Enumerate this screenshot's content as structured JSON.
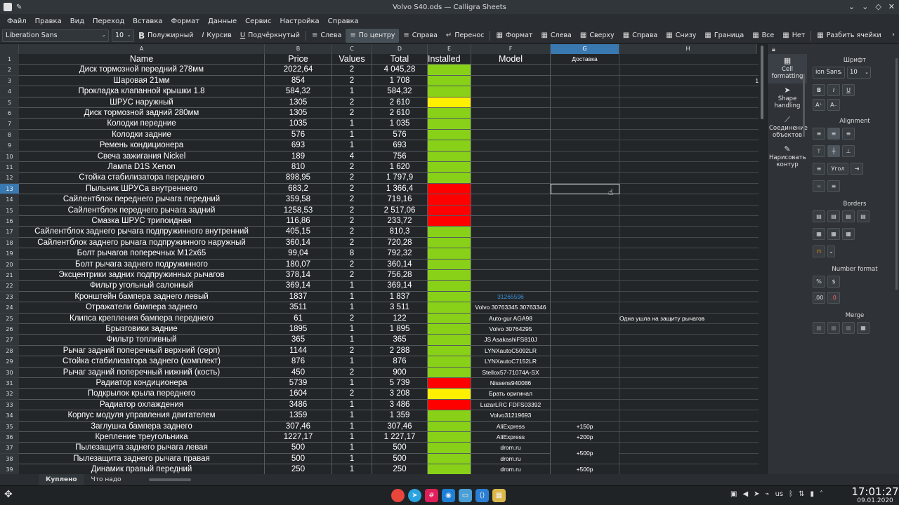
{
  "window": {
    "title": "Volvo S40.ods — Calligra Sheets"
  },
  "menu": [
    "Файл",
    "Правка",
    "Вид",
    "Переход",
    "Вставка",
    "Формат",
    "Данные",
    "Сервис",
    "Настройка",
    "Справка"
  ],
  "toolbar": {
    "font": "Liberation Sans",
    "size": "10",
    "bold": "Полужирный",
    "italic": "Курсив",
    "underline": "Подчёркнутый",
    "left": "Слева",
    "center": "По центру",
    "right": "Справа",
    "wrap": "Перенос",
    "format": "Формат",
    "b_left": "Слева",
    "b_top": "Сверху",
    "b_right": "Справа",
    "b_bottom": "Снизу",
    "b_border": "Граница",
    "b_all": "Все",
    "b_none": "Нет",
    "split": "Разбить ячейки"
  },
  "columns": [
    "A",
    "B",
    "C",
    "D",
    "E",
    "F",
    "G",
    "H"
  ],
  "header": {
    "name": "Name",
    "price": "Price",
    "values": "Values",
    "total": "Total",
    "installed": "Installed",
    "model": "Model",
    "g": "Доставка"
  },
  "rows": [
    {
      "n": "2",
      "a": "Диск тормозной передний 278мм",
      "b": "2022,64",
      "c": "2",
      "d": "4 045,28",
      "e": "green",
      "f": "",
      "g": "",
      "h": "",
      "i": ""
    },
    {
      "n": "3",
      "a": "Шаровая 21мм",
      "b": "854",
      "c": "2",
      "d": "1 708",
      "e": "green",
      "f": "",
      "g": "",
      "h": "",
      "i": "1"
    },
    {
      "n": "4",
      "a": "Прокладка клапанной крышки 1.8",
      "b": "584,32",
      "c": "1",
      "d": "584,32",
      "e": "green",
      "f": "",
      "g": "",
      "h": "",
      "i": ""
    },
    {
      "n": "5",
      "a": "ШРУС наружный",
      "b": "1305",
      "c": "2",
      "d": "2 610",
      "e": "yellow",
      "f": "",
      "g": "",
      "h": "",
      "i": ""
    },
    {
      "n": "6",
      "a": "Диск тормозной задний 280мм",
      "b": "1305",
      "c": "2",
      "d": "2 610",
      "e": "green",
      "f": "",
      "g": "",
      "h": "",
      "i": ""
    },
    {
      "n": "7",
      "a": "Колодки передние",
      "b": "1035",
      "c": "1",
      "d": "1 035",
      "e": "green",
      "f": "",
      "g": "",
      "h": "",
      "i": ""
    },
    {
      "n": "8",
      "a": "Колодки задние",
      "b": "576",
      "c": "1",
      "d": "576",
      "e": "green",
      "f": "",
      "g": "",
      "h": "",
      "i": ""
    },
    {
      "n": "9",
      "a": "Ремень кондиционера",
      "b": "693",
      "c": "1",
      "d": "693",
      "e": "green",
      "f": "",
      "g": "",
      "h": "",
      "i": ""
    },
    {
      "n": "10",
      "a": "Свеча зажигания Nickel",
      "b": "189",
      "c": "4",
      "d": "756",
      "e": "green",
      "f": "",
      "g": "",
      "h": "",
      "i": ""
    },
    {
      "n": "11",
      "a": "Лампа D1S Xenon",
      "b": "810",
      "c": "2",
      "d": "1 620",
      "e": "green",
      "f": "",
      "g": "",
      "h": "",
      "i": ""
    },
    {
      "n": "12",
      "a": "Стойка стабилизатора переднего",
      "b": "898,95",
      "c": "2",
      "d": "1 797,9",
      "e": "green",
      "f": "",
      "g": "",
      "h": "",
      "i": ""
    },
    {
      "n": "13",
      "a": "Пыльник ШРУСа внутреннего",
      "b": "683,2",
      "c": "2",
      "d": "1 366,4",
      "e": "red",
      "f": "",
      "g": "",
      "h": "",
      "i": ""
    },
    {
      "n": "14",
      "a": "Сайлентблок переднего рычага передний",
      "b": "359,58",
      "c": "2",
      "d": "719,16",
      "e": "red",
      "f": "",
      "g": "",
      "h": "",
      "i": ""
    },
    {
      "n": "15",
      "a": "Сайлентблок переднего рычага задний",
      "b": "1258,53",
      "c": "2",
      "d": "2 517,06",
      "e": "red",
      "f": "",
      "g": "",
      "h": "",
      "i": ""
    },
    {
      "n": "16",
      "a": "Смазка ШРУС трипоидная",
      "b": "116,86",
      "c": "2",
      "d": "233,72",
      "e": "red",
      "f": "",
      "g": "",
      "h": "",
      "i": ""
    },
    {
      "n": "17",
      "a": "Сайлентблок заднего рычага подпружинного внутренний",
      "b": "405,15",
      "c": "2",
      "d": "810,3",
      "e": "green",
      "f": "",
      "g": "",
      "h": "",
      "i": ""
    },
    {
      "n": "18",
      "a": "Сайлентблок заднего рычага подпружинного наружный",
      "b": "360,14",
      "c": "2",
      "d": "720,28",
      "e": "green",
      "f": "",
      "g": "",
      "h": "",
      "i": ""
    },
    {
      "n": "19",
      "a": "Болт рычагов поперечных M12x65",
      "b": "99,04",
      "c": "8",
      "d": "792,32",
      "e": "green",
      "f": "",
      "g": "",
      "h": "",
      "i": ""
    },
    {
      "n": "20",
      "a": "Болт рычага заднего подружинного",
      "b": "180,07",
      "c": "2",
      "d": "360,14",
      "e": "green",
      "f": "",
      "g": "",
      "h": "",
      "i": ""
    },
    {
      "n": "21",
      "a": "Эксцентрики задних подпружинных рычагов",
      "b": "378,14",
      "c": "2",
      "d": "756,28",
      "e": "green",
      "f": "",
      "g": "",
      "h": "",
      "i": ""
    },
    {
      "n": "22",
      "a": "Фильтр угольный салонный",
      "b": "369,14",
      "c": "1",
      "d": "369,14",
      "e": "green",
      "f": "",
      "g": "",
      "h": "",
      "i": ""
    },
    {
      "n": "23",
      "a": "Кронштейн бампера заднего левый",
      "b": "1837",
      "c": "1",
      "d": "1 837",
      "e": "green",
      "f": "31265596",
      "g": "",
      "h": "",
      "i": "",
      "flink": true
    },
    {
      "n": "24",
      "a": "Отражатели бампера заднего",
      "b": "3511",
      "c": "1",
      "d": "3 511",
      "e": "green",
      "f": "Volvo 30763345 30763346",
      "g": "",
      "h": "",
      "i": ""
    },
    {
      "n": "25",
      "a": "Клипса крепления бампера переднего",
      "b": "61",
      "c": "2",
      "d": "122",
      "e": "green",
      "f": "Auto-gur AGA98",
      "g": "",
      "h": "Одна ушла на защиту рычагов",
      "i": ""
    },
    {
      "n": "26",
      "a": "Брызговики задние",
      "b": "1895",
      "c": "1",
      "d": "1 895",
      "e": "green",
      "f": "Volvo 30764295",
      "g": "",
      "h": "",
      "i": ""
    },
    {
      "n": "27",
      "a": "Фильтр топливный",
      "b": "365",
      "c": "1",
      "d": "365",
      "e": "green",
      "f": "JS AsakashiFS810J",
      "g": "",
      "h": "",
      "i": ""
    },
    {
      "n": "28",
      "a": "Рычаг задний поперечный верхний (серп)",
      "b": "1144",
      "c": "2",
      "d": "2 288",
      "e": "green",
      "f": "LYNXautoC5092LR",
      "g": "",
      "h": "",
      "i": ""
    },
    {
      "n": "29",
      "a": "Стойка стабилизатора заднего (комплект)",
      "b": "876",
      "c": "1",
      "d": "876",
      "e": "green",
      "f": "LYNXautoC7152LR",
      "g": "",
      "h": "",
      "i": ""
    },
    {
      "n": "30",
      "a": "Рычаг задний поперечный нижний (кость)",
      "b": "450",
      "c": "2",
      "d": "900",
      "e": "green",
      "f": "Stellox57-71074A-SX",
      "g": "",
      "h": "",
      "i": ""
    },
    {
      "n": "31",
      "a": "Радиатор кондиционера",
      "b": "5739",
      "c": "1",
      "d": "5 739",
      "e": "red",
      "f": "Nissens940086",
      "g": "",
      "h": "",
      "i": ""
    },
    {
      "n": "32",
      "a": "Подкрылок крыла переднего",
      "b": "1604",
      "c": "2",
      "d": "3 208",
      "e": "yellow",
      "f": "Брать оригинал",
      "g": "",
      "h": "",
      "i": ""
    },
    {
      "n": "33",
      "a": "Радиатор охлаждения",
      "b": "3486",
      "c": "1",
      "d": "3 486",
      "e": "red",
      "f": "LuzarLRC FDFS03392",
      "g": "",
      "h": "",
      "i": ""
    },
    {
      "n": "34",
      "a": "Корпус модуля управления двигателем",
      "b": "1359",
      "c": "1",
      "d": "1 359",
      "e": "green",
      "f": "Volvo31219693",
      "g": "",
      "h": "",
      "i": ""
    },
    {
      "n": "35",
      "a": "Заглушка бампера заднего",
      "b": "307,46",
      "c": "1",
      "d": "307,46",
      "e": "green",
      "f": "AliExpress",
      "g": "+150р",
      "h": "",
      "i": ""
    },
    {
      "n": "36",
      "a": "Крепление треугольника",
      "b": "1227,17",
      "c": "1",
      "d": "1 227,17",
      "e": "green",
      "f": "AliExpress",
      "g": "+200р",
      "h": "",
      "i": ""
    },
    {
      "n": "37",
      "a": "Пылезащита заднего рычага левая",
      "b": "500",
      "c": "1",
      "d": "500",
      "e": "green",
      "f": "drom.ru",
      "g": "",
      "h": "",
      "i": ""
    },
    {
      "n": "38",
      "a": "Пылезащита заднего рычага правая",
      "b": "500",
      "c": "1",
      "d": "500",
      "e": "green",
      "f": "drom.ru",
      "g": "",
      "h": "",
      "i": ""
    },
    {
      "n": "39",
      "a": "Динамик правый передний",
      "b": "250",
      "c": "1",
      "d": "250",
      "e": "green",
      "f": "drom.ru",
      "g": "+500р",
      "h": "",
      "i": ""
    }
  ],
  "merged_g": "+500р",
  "tabs": [
    "Куплено",
    "Что надо"
  ],
  "docker": {
    "tabs": [
      "Cell formatting",
      "Shape handling",
      "Соединение объектов",
      "Нарисовать контур"
    ],
    "font_title": "Шрифт",
    "font_value": "ion Sans",
    "font_size": "10",
    "alignment_title": "Alignment",
    "angle": "Угол",
    "borders_title": "Borders",
    "number_format_title": "Number format",
    "merge_title": "Merge"
  },
  "taskbar": {
    "lang": "us",
    "time": "17:01:27",
    "date": "09.01.2020"
  }
}
